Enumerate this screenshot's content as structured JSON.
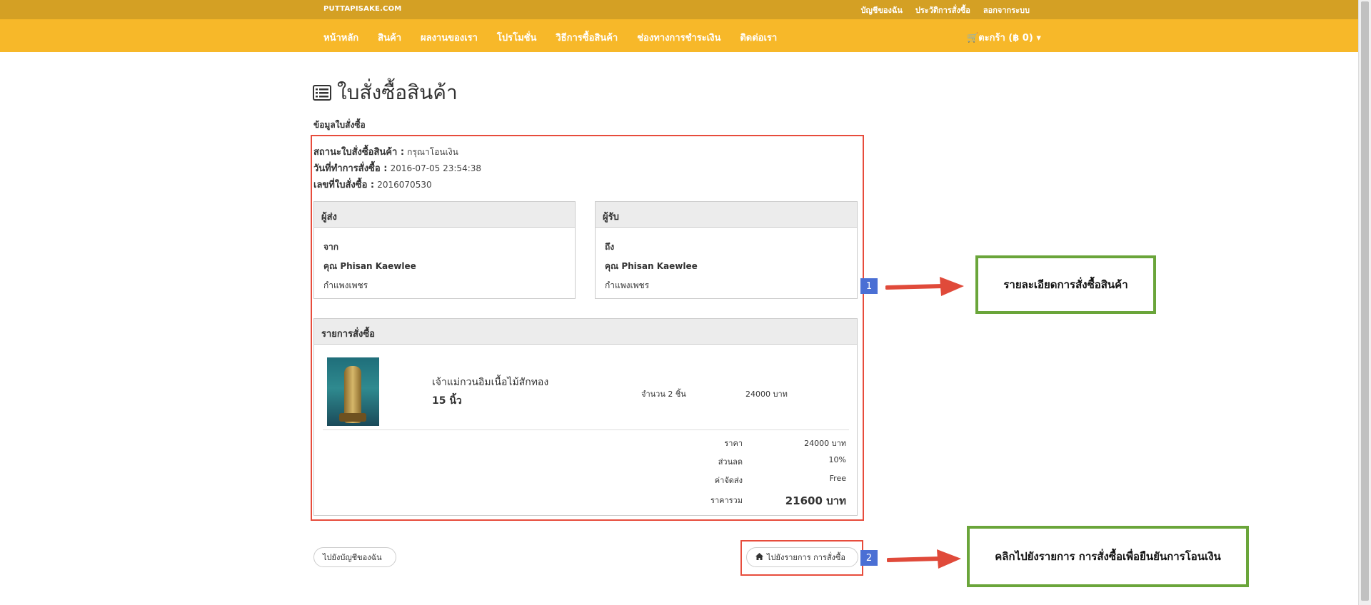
{
  "header": {
    "brand": "PUTTAPISAKE.COM",
    "top_links": [
      "บัญชีของฉัน",
      "ประวัติการสั่งซื้อ",
      "ลอกจากระบบ"
    ],
    "nav": [
      "หน้าหลัก",
      "สินค้า",
      "ผลงานของเรา",
      "โปรโมชั่น",
      "วิธีการซื้อสินค้า",
      "ช่องทางการชำระเงิน",
      "ติดต่อเรา"
    ],
    "cart": "ตะกร้า (฿ 0)",
    "cart_icon": "shopping-cart-icon"
  },
  "page": {
    "title": "ใบสั่งซื้อสินค้า",
    "title_icon": "list-alt-icon",
    "section_label": "ข้อมูลใบสั่งซื้อ"
  },
  "order": {
    "status_label": "สถานะใบสั่งซื้อสินค้า :",
    "status_value": "กรุณาโอนเงิน",
    "date_label": "วันที่ทำการสั่งซื้อ :",
    "date_value": "2016-07-05 23:54:38",
    "number_label": "เลขที่ใบสั่งซื้อ :",
    "number_value": "2016070530"
  },
  "sender": {
    "heading": "ผู้ส่ง",
    "from_label": "จาก",
    "name": "คุณ Phisan  Kaewlee",
    "location": "กำแพงเพชร"
  },
  "receiver": {
    "heading": "ผู้รับ",
    "to_label": "ถึง",
    "name": "คุณ Phisan Kaewlee",
    "location": "กำแพงเพชร"
  },
  "items": {
    "heading": "รายการสั่งซื้อ",
    "product_name": "เจ้าแม่กวนอิมเนื้อไม้สักทอง",
    "product_size": "15 นิ้ว",
    "quantity": "จำนวน 2 ชิ้น",
    "price": "24000 บาท"
  },
  "summary": [
    {
      "key": "ราคา",
      "value": "24000 บาท"
    },
    {
      "key": "ส่วนลด",
      "value": "10%"
    },
    {
      "key": "ค่าจัดส่ง",
      "value": "Free"
    },
    {
      "key": "ราคารวม",
      "value": "21600 บาท"
    }
  ],
  "buttons": {
    "account": "ไปยังบัญชีของฉัน",
    "orders": "ไปยังรายการ การสั่งซื้อ",
    "orders_icon": "home-icon"
  },
  "annotations": {
    "badge1": "1",
    "badge2": "2",
    "callout1": "รายละเอียดการสั่งซื้อสินค้า",
    "callout2": "คลิกไปยังรายการ การสั่งซื้อเพื่อยืนยันการโอนเงิน",
    "highlight_color": "#e74c3c",
    "callout_border_color": "#6aa53a",
    "badge_color": "#4a6fd4"
  },
  "colors": {
    "topbar": "#d4a024",
    "navbar": "#f7b829"
  }
}
